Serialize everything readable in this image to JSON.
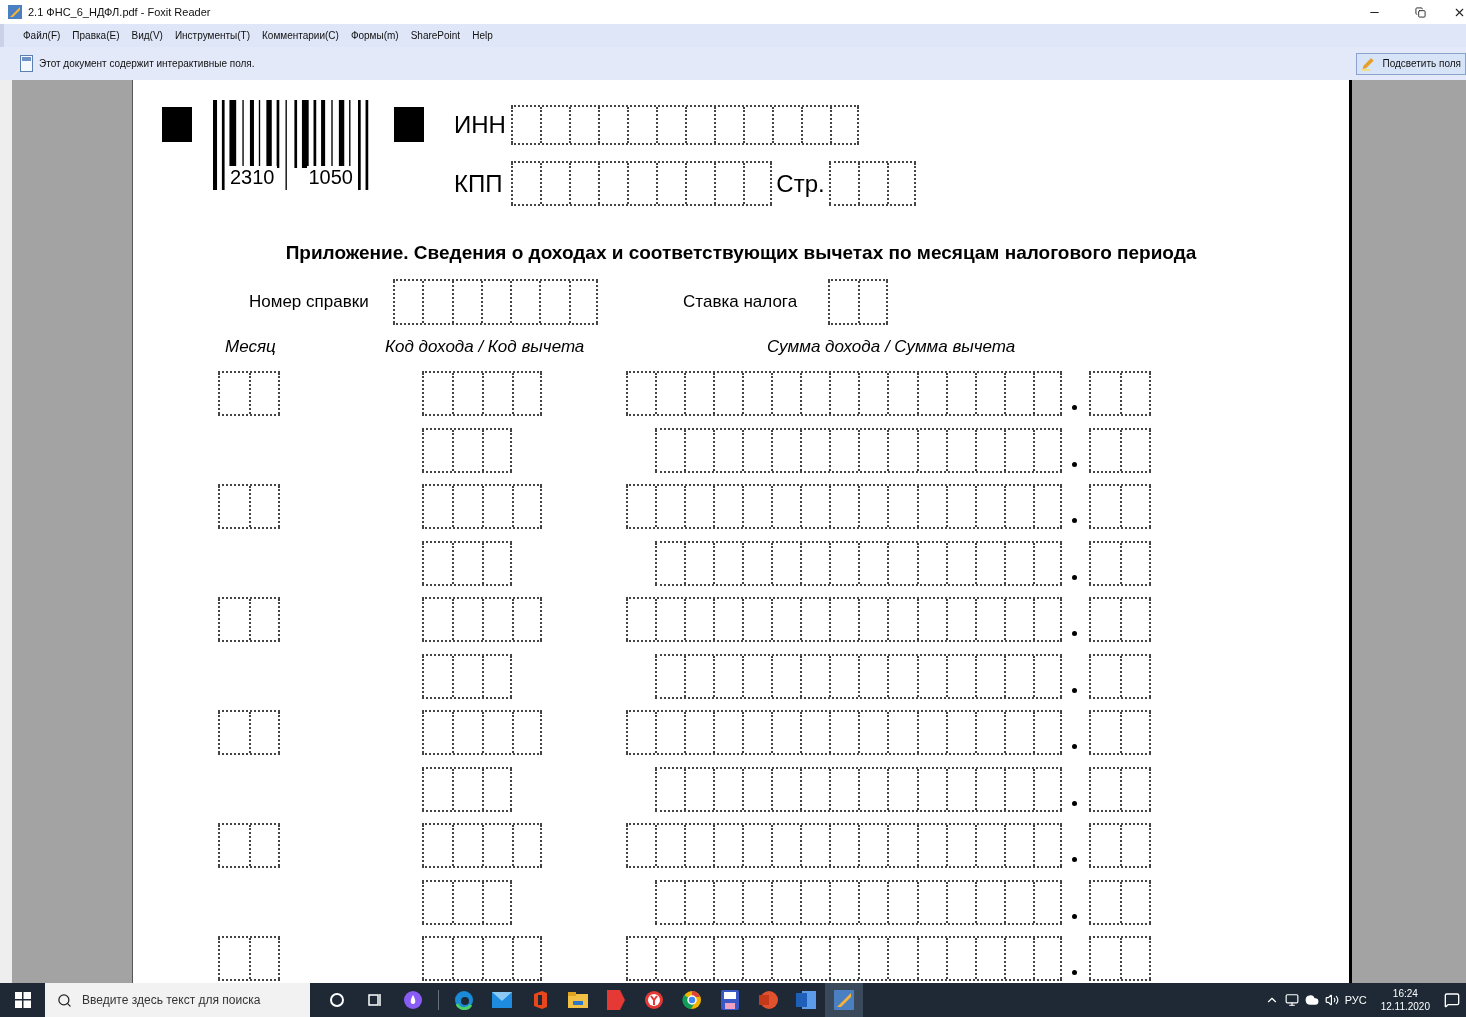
{
  "window": {
    "title": "2.1 ФНС_6_НДФЛ.pdf - Foxit Reader"
  },
  "menu": [
    "Файл(F)",
    "Правка(E)",
    "Вид(V)",
    "Инструменты(T)",
    "Комментарии(C)",
    "Формы(m)",
    "SharePoint",
    "Help"
  ],
  "infobar": {
    "message": "Этот документ содержит интерактивные поля.",
    "button": "Подсветить поля"
  },
  "form": {
    "barcode_numbers": [
      "2310",
      "1050"
    ],
    "inn_label": "ИНН",
    "kpp_label": "КПП",
    "page_label": "Стр.",
    "title": "Приложение. Сведения о доходах и соответствующих вычетах по месяцам налогового периода",
    "certificate_label": "Номер справки",
    "tax_rate_label": "Ставка налога",
    "columns": [
      "Месяц",
      "Код дохода / Код вычета",
      "Сумма дохода / Сумма вычета"
    ],
    "rows": [
      {
        "kind": "income"
      },
      {
        "kind": "deduction"
      },
      {
        "kind": "income"
      },
      {
        "kind": "deduction"
      },
      {
        "kind": "income"
      },
      {
        "kind": "deduction"
      },
      {
        "kind": "income"
      },
      {
        "kind": "deduction"
      },
      {
        "kind": "income"
      },
      {
        "kind": "deduction"
      },
      {
        "kind": "income"
      }
    ]
  },
  "taskbar": {
    "search_placeholder": "Введите здесь текст для поиска",
    "language": "РУС",
    "time": "16:24",
    "date": "12.11.2020"
  }
}
